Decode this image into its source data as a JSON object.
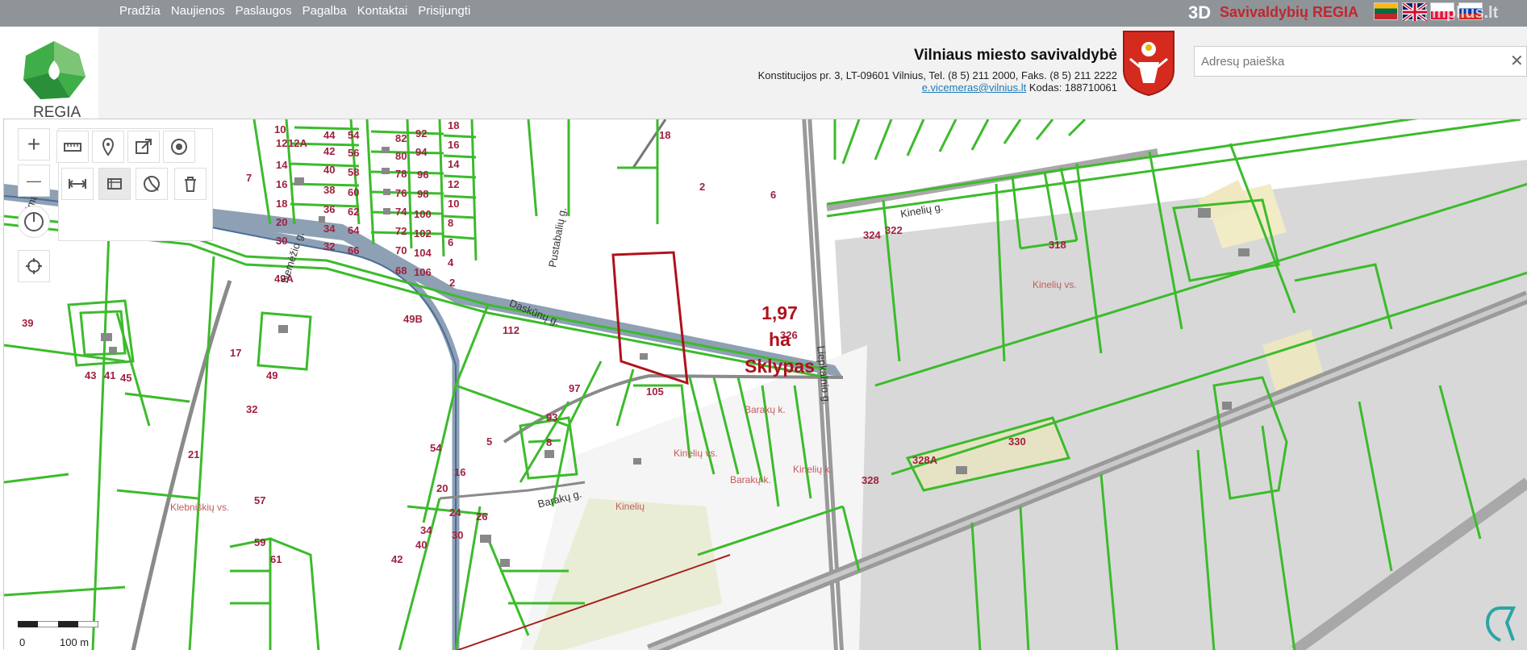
{
  "topnav": {
    "items": [
      "Pradžia",
      "Naujienos",
      "Paslaugos",
      "Pagalba",
      "Kontaktai",
      "Prisijungti"
    ]
  },
  "brand": {
    "prefix": "3D",
    "name": "Savivaldybių REGIA",
    "languages": [
      "lt",
      "en",
      "pl",
      "ru"
    ],
    "watermark": "mplius.lt"
  },
  "logo": {
    "text": "REGIA"
  },
  "municipality": {
    "title": "Vilniaus miesto savivaldybė",
    "address": "Konstitucijos pr. 3, LT-09601 Vilnius, Tel. (8 5) 211 2000, Faks. (8 5) 211 2222",
    "email": "e.vicemeras@vilnius.lt",
    "code": "Kodas: 188710061"
  },
  "search": {
    "placeholder": "Adresų paieška",
    "clear_icon": "close-icon"
  },
  "tools": {
    "zoom_in": "+",
    "zoom_out": "—",
    "row1": [
      "ruler-icon",
      "marker-icon",
      "export-icon",
      "target-icon"
    ],
    "row2": [
      "measure-distance-icon",
      "measure-area-icon",
      "identify-icon",
      "trash-icon"
    ],
    "side": [
      "compass-icon",
      "locate-icon"
    ]
  },
  "plot": {
    "line1": "1,97",
    "line2": "ha",
    "line3": "Sklypas"
  },
  "map_labels": {
    "plots": [
      "10",
      "44",
      "54",
      "82",
      "92",
      "18",
      "12",
      "12A",
      "42",
      "56",
      "80",
      "94",
      "16",
      "14",
      "40",
      "58",
      "78",
      "96",
      "14",
      "16",
      "38",
      "60",
      "76",
      "98",
      "12",
      "18",
      "36",
      "62",
      "74",
      "100",
      "10",
      "20",
      "34",
      "64",
      "72",
      "102",
      "8",
      "30",
      "32",
      "66",
      "70",
      "104",
      "6",
      "68",
      "106",
      "4",
      "2",
      "7",
      "49A",
      "49B",
      "39",
      "17",
      "49",
      "43",
      "41",
      "45",
      "32",
      "112",
      "97",
      "93",
      "8",
      "5",
      "21",
      "2",
      "6",
      "324",
      "322",
      "318",
      "326",
      "105",
      "16",
      "20",
      "54",
      "24",
      "26",
      "34",
      "30",
      "40",
      "42",
      "57",
      "59",
      "61",
      "328",
      "330",
      "328A",
      "18"
    ],
    "streets": [
      "Nemėžio g.",
      "Daskūnų g.",
      "Pustabalių g.",
      "Liepkalnio g.",
      "Kinelių g.",
      "Barakų g.",
      "Žygimantų g."
    ],
    "context": [
      "Kinelių vs.",
      "Barakų k.",
      "Kinelių vs.",
      "Kinelių k.",
      "Klebniškių vs.",
      "Kinelių",
      "Barakų k."
    ]
  },
  "scale": {
    "zero": "0",
    "hundred": "100 m"
  }
}
